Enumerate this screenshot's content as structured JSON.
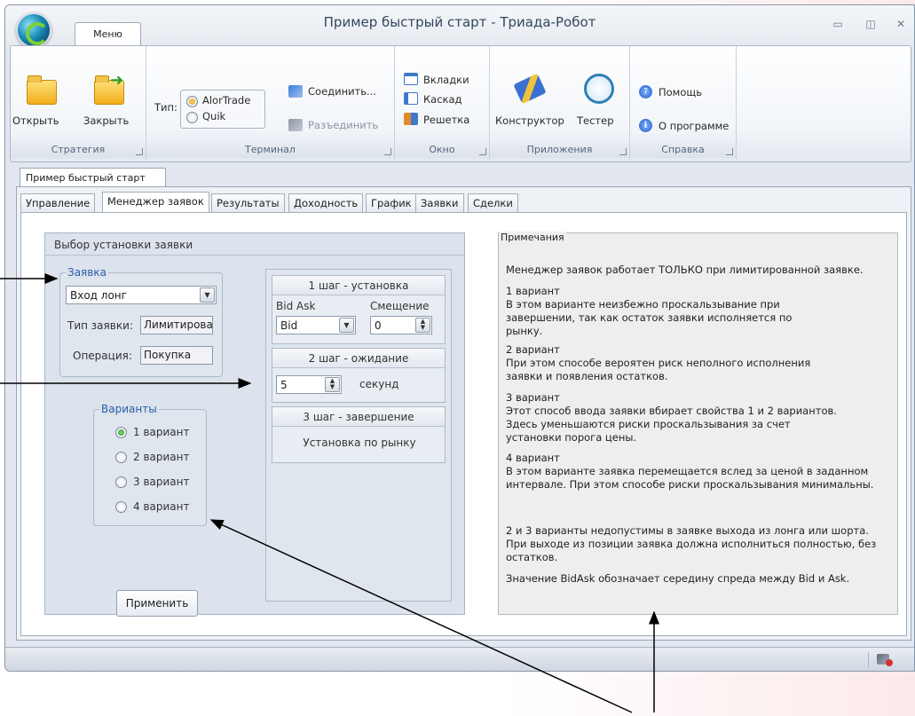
{
  "window": {
    "title": "Пример быстрый старт - Триада-Робот",
    "controls": [
      "▭",
      "◫",
      "✕"
    ]
  },
  "menu_tab": "Меню",
  "ribbon": {
    "strategy": {
      "open": "Открыть",
      "close": "Закрыть",
      "label": "Стратегия"
    },
    "terminal": {
      "type_label": "Тип:",
      "options": [
        "AlorTrade",
        "Quik"
      ],
      "selected": "AlorTrade",
      "connect": "Соединить...",
      "disconnect": "Разъединить",
      "label": "Терминал"
    },
    "window": {
      "tabs": "Вкладки",
      "cascade": "Каскад",
      "grid": "Решетка",
      "label": "Окно"
    },
    "apps": {
      "constructor": "Конструктор",
      "tester": "Тестер",
      "label": "Приложения"
    },
    "help": {
      "help": "Помощь",
      "about": "О программе",
      "label": "Справка"
    }
  },
  "doc_tab": "Пример быстрый старт",
  "tabs": [
    "Управление",
    "Менеджер заявок",
    "Результаты",
    "Доходность",
    "График",
    "Заявки",
    "Сделки"
  ],
  "active_tab": "Менеджер заявок",
  "setup": {
    "title": "Выбор установки заявки",
    "order": {
      "legend": "Заявка",
      "type_value": "Вход лонг",
      "order_type_label": "Тип заявки:",
      "order_type_value": "Лимитирован",
      "operation_label": "Операция:",
      "operation_value": "Покупка"
    },
    "variants": {
      "legend": "Варианты",
      "items": [
        "1 вариант",
        "2 вариант",
        "3 вариант",
        "4 вариант"
      ],
      "selected": "1 вариант"
    },
    "step1": {
      "title": "1 шаг - установка",
      "bidask_label": "Bid Ask",
      "offset_label": "Смещение",
      "bidask_value": "Bid",
      "offset_value": "0"
    },
    "step2": {
      "title": "2 шаг - ожидание",
      "seconds_value": "5",
      "seconds_label": "секунд"
    },
    "step3": {
      "title": "3 шаг - завершение",
      "text": "Установка по рынку"
    },
    "apply": "Применить"
  },
  "notes": {
    "legend": "Примечания",
    "intro": "Менеджер заявок работает ТОЛЬКО при лимитированной заявке.",
    "v1_title": "1 вариант",
    "v1_text": "В этом варианте неизбежно проскальзывание при завершении, так как остаток заявки исполняется по рынку.",
    "v2_title": "2 вариант",
    "v2_text": "При этом способе вероятен риск неполного исполнения заявки и появления остатков.",
    "v3_title": "3 вариант",
    "v3_text": "Этот способ ввода заявки вбирает свойства 1 и 2 вариантов. Здесь уменьшаются риски проскальзывания за счет установки порога цены.",
    "v4_title": "4 вариант",
    "v4_text": "В этом варианте заявка перемещается вслед за ценой в заданном интервале. При этом способе риски проскальзывания минимальны.",
    "p1": "2 и 3 варианты недопустимы в заявке выхода из лонга или шорта. При выходе из позиции заявка должна исполниться полностью, без остатков.",
    "p2": "Значение BidAsk обозначает середину спреда между Bid и Ask."
  }
}
